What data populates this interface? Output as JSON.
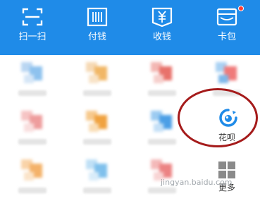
{
  "actions": [
    {
      "label": "扫一扫",
      "icon": "scan-icon"
    },
    {
      "label": "付钱",
      "icon": "barcode-pay-icon"
    },
    {
      "label": "收钱",
      "icon": "yuan-receive-icon"
    },
    {
      "label": "卡包",
      "icon": "wallet-card-icon",
      "has_badge": true
    }
  ],
  "grid": {
    "huabei_label": "花呗",
    "more_label": "更多"
  },
  "watermark": "jingyan.baidu.com",
  "colors": {
    "topbar": "#1f8be8",
    "highlight_ring": "#a51b1b",
    "badge": "#ff3b30",
    "huabei_blue": "#1f8be8"
  }
}
